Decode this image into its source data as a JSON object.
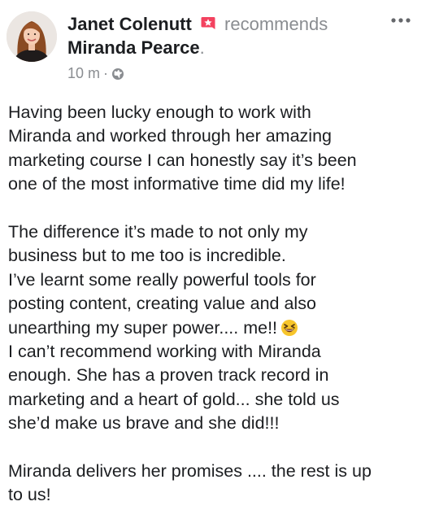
{
  "post": {
    "author": "Janet Colenutt",
    "action": "recommends",
    "recommended_page": "Miranda Pearce",
    "punctuation": ".",
    "time": "10 m",
    "separator": "·",
    "privacy_icon": "globe-icon",
    "recommend_icon": "recommend-star-icon",
    "more_icon": "more-options-icon",
    "accent_color": "#f3425f",
    "paragraph_lines": [
      "Having been lucky enough to work with",
      "Miranda and worked through her amazing",
      "marketing course I can honestly say it’s been",
      "one of the most informative time did my life!",
      "",
      "The difference it’s made to not only my",
      "business but to me too is incredible.",
      "I’ve learnt some really powerful tools for",
      "posting content, creating value and also",
      "unearthing my super power.... me!!",
      "I can’t recommend working with Miranda",
      "enough. She has a proven track record in",
      "marketing and a heart of gold... she told us",
      "she’d make us brave and she did!!!",
      "",
      "Miranda delivers her promises .... the rest is up",
      "to us!"
    ],
    "emoji": "grinning-squinting-face-emoji"
  }
}
